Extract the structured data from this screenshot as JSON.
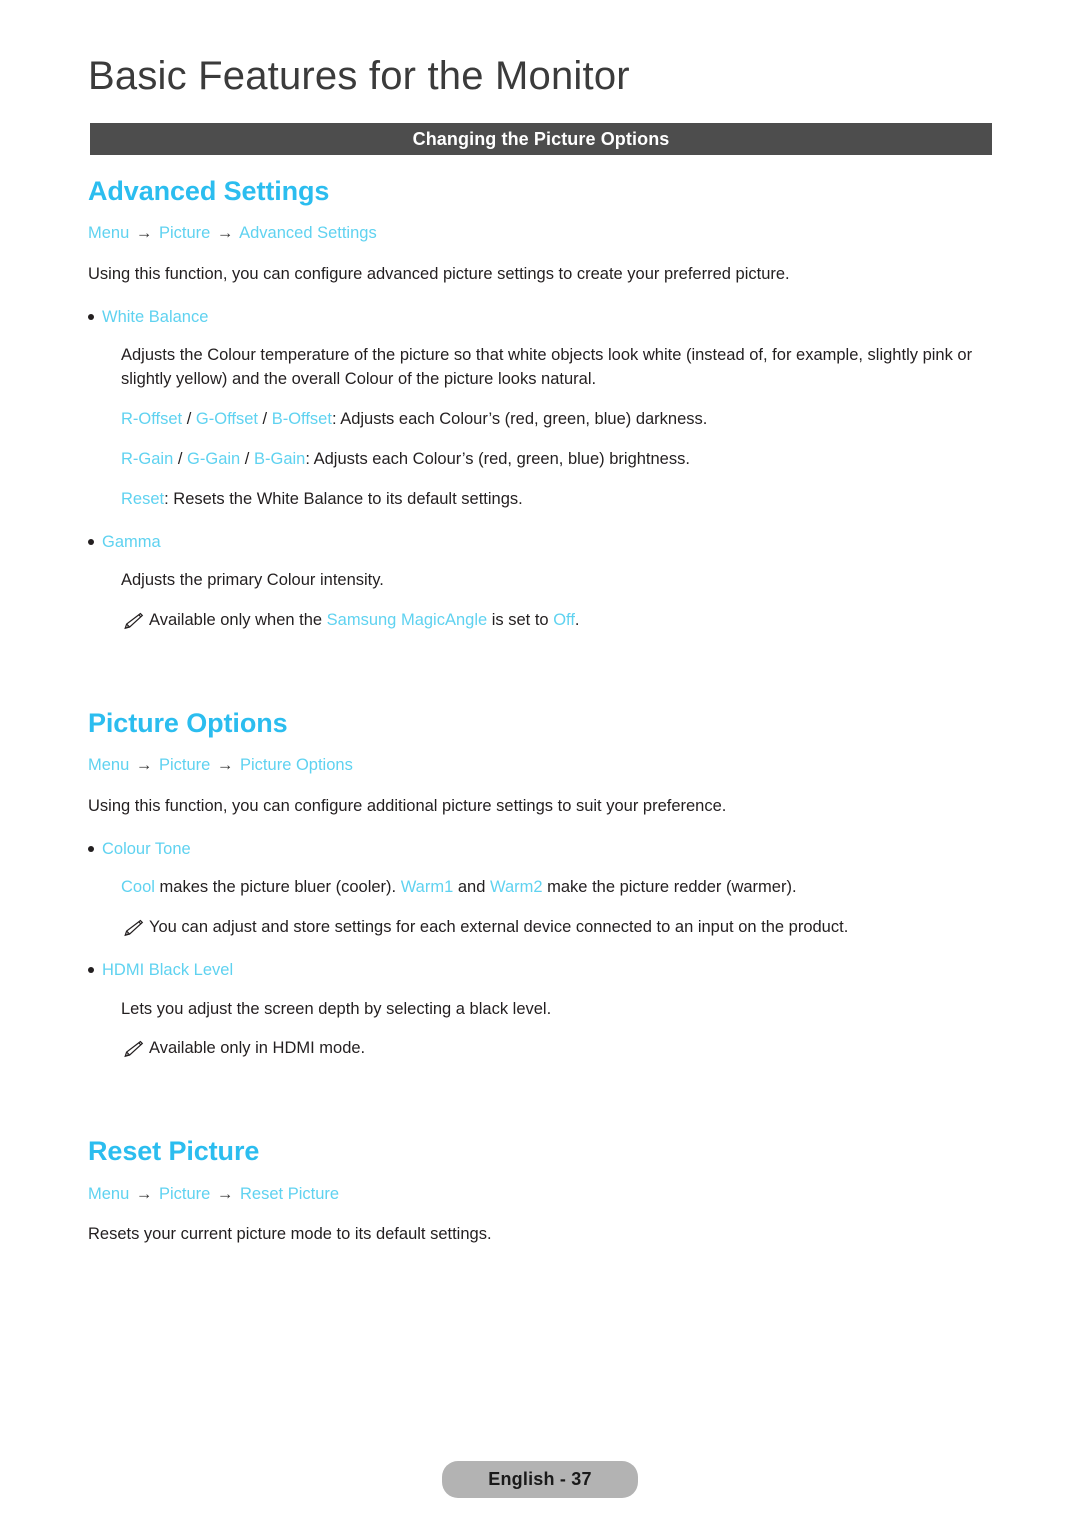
{
  "header": {
    "title": "Basic Features for the Monitor",
    "section_bar_label": "Changing the Picture Options",
    "bar_color": "#4d4d4d"
  },
  "theme": {
    "heading_blue": "#2bbdef",
    "term_blue": "#5fd2f0",
    "body_text": "#231f20",
    "pill_bg": "#b3b3b3"
  },
  "sections": [
    {
      "heading": "Advanced Settings",
      "breadcrumb": {
        "item1": "Menu",
        "arrow1": "→",
        "item2": "Picture",
        "arrow2": "→",
        "item3": "Advanced Settings"
      },
      "intro": "Using this function, you can configure advanced picture settings to create your preferred picture.",
      "items": [
        {
          "label": "White Balance",
          "description": "Adjusts the Colour temperature of the picture so that white objects look white (instead of, for example, slightly pink or slightly yellow) and the overall Colour of the picture looks natural.",
          "lines": [
            {
              "terms": [
                "R-Offset",
                "G-Offset",
                "B-Offset"
              ],
              "separator": " / ",
              "rest": ": Adjusts each Colour’s (red, green, blue) darkness."
            },
            {
              "terms": [
                "R-Gain",
                "G-Gain",
                "B-Gain"
              ],
              "separator": " / ",
              "rest": ": Adjusts each Colour’s (red, green, blue) brightness."
            },
            {
              "terms": [
                "Reset"
              ],
              "separator": "",
              "rest": ": Resets the White Balance to its default settings."
            }
          ]
        },
        {
          "label": "Gamma",
          "description": "Adjusts the primary Colour intensity.",
          "note": {
            "icon": "pencil-note-icon",
            "prefix": "Available only when the ",
            "term1": "Samsung MagicAngle",
            "middle": " is set to ",
            "term2": "Off",
            "suffix": "."
          }
        }
      ]
    },
    {
      "heading": "Picture Options",
      "breadcrumb": {
        "item1": "Menu",
        "arrow1": "→",
        "item2": "Picture",
        "arrow2": "→",
        "item3": "Picture Options"
      },
      "intro": "Using this function, you can configure additional picture settings to suit your preference.",
      "items": [
        {
          "label": "Colour Tone",
          "description_parts": {
            "term1": "Cool",
            "mid1": " makes the picture bluer (cooler). ",
            "term2": "Warm1",
            "mid2": " and ",
            "term3": "Warm2",
            "tail": " make the picture redder (warmer)."
          },
          "note": {
            "icon": "pencil-note-icon",
            "text": "You can adjust and store settings for each external device connected to an input on the product."
          }
        },
        {
          "label": "HDMI Black Level",
          "description": "Lets you adjust the screen depth by selecting a black level.",
          "note": {
            "icon": "pencil-note-icon",
            "text": "Available only in HDMI mode."
          }
        }
      ]
    },
    {
      "heading": "Reset Picture",
      "breadcrumb": {
        "item1": "Menu",
        "arrow1": "→",
        "item2": "Picture",
        "arrow2": "→",
        "item3": "Reset Picture"
      },
      "intro": "Resets your current picture mode to its default settings."
    }
  ],
  "footer": {
    "page_label": "English - 37"
  }
}
